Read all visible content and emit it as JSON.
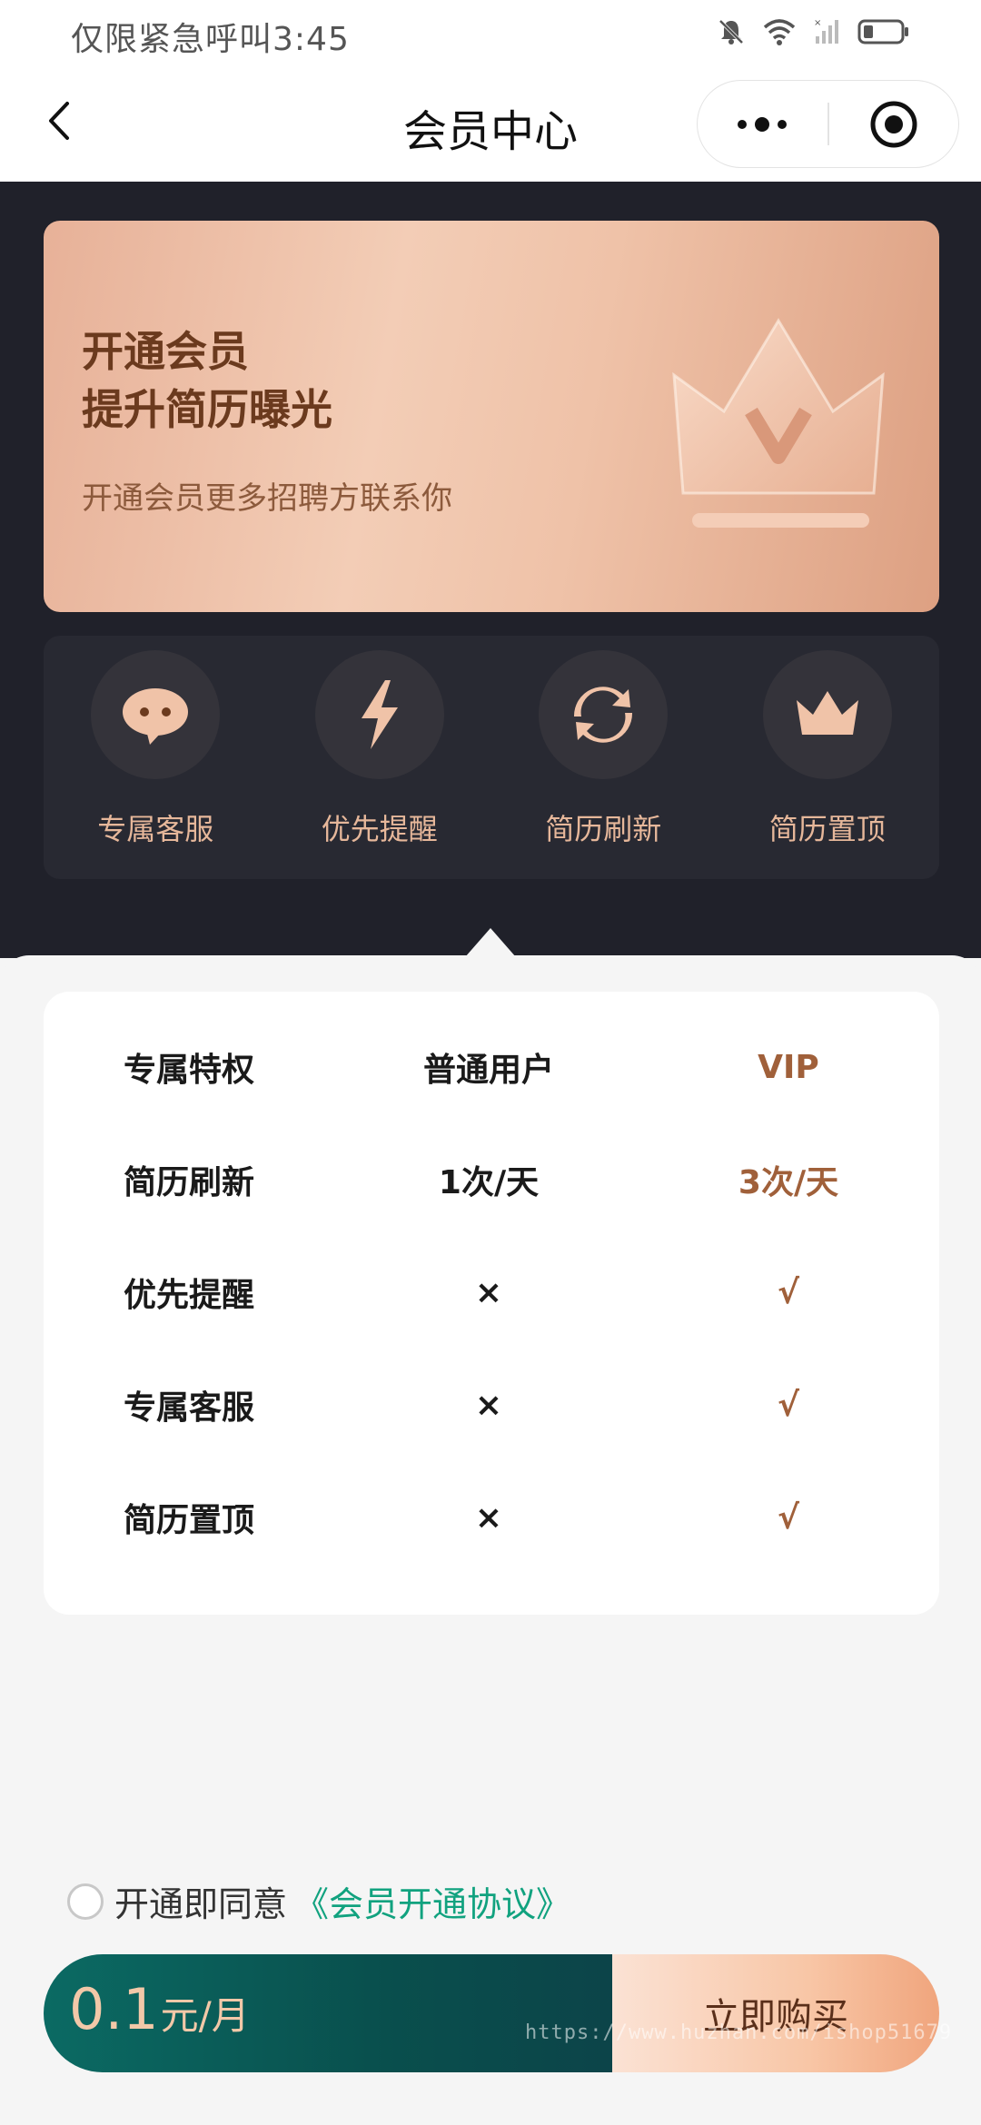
{
  "status_bar": {
    "text": "仅限紧急呼叫3:45"
  },
  "nav": {
    "title": "会员中心"
  },
  "banner": {
    "title_line1": "开通会员",
    "title_line2": "提升简历曝光",
    "subtitle": "开通会员更多招聘方联系你"
  },
  "benefits": [
    {
      "label": "专属客服",
      "icon": "chat-bubble-icon"
    },
    {
      "label": "优先提醒",
      "icon": "lightning-icon"
    },
    {
      "label": "简历刷新",
      "icon": "refresh-icon"
    },
    {
      "label": "简历置顶",
      "icon": "crown-icon"
    }
  ],
  "table": {
    "header": [
      "专属特权",
      "普通用户",
      "VIP"
    ],
    "rows": [
      [
        "简历刷新",
        "1次/天",
        "3次/天"
      ],
      [
        "优先提醒",
        "×",
        "√"
      ],
      [
        "专属客服",
        "×",
        "√"
      ],
      [
        "简历置顶",
        "×",
        "√"
      ]
    ]
  },
  "agreement": {
    "text": "开通即同意",
    "link": "《会员开通协议》"
  },
  "purchase": {
    "price": "0.1",
    "unit": "元/月",
    "button": "立即购买"
  },
  "watermark": "https://www.huzhan.com/ishop51679",
  "colors": {
    "accent_brown": "#a0603a",
    "teal": "#0b6a63",
    "link_green": "#11a27f"
  }
}
